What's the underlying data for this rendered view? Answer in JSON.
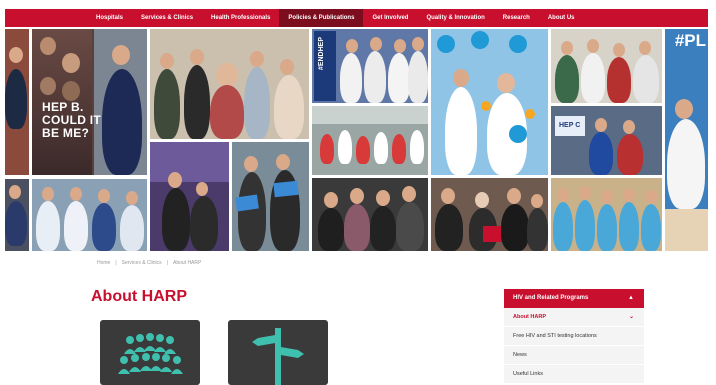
{
  "nav": {
    "items": [
      {
        "label": "Hospitals"
      },
      {
        "label": "Services & Clinics"
      },
      {
        "label": "Health Professionals"
      },
      {
        "label": "Policies & Publications",
        "active": true
      },
      {
        "label": "Get Involved"
      },
      {
        "label": "Quality & Innovation"
      },
      {
        "label": "Research"
      },
      {
        "label": "About Us"
      }
    ]
  },
  "hero": {
    "hepb_text": [
      "HEP B.",
      "COULD IT",
      "BE ME?"
    ],
    "banner_text": "#ENDHEP",
    "hashtag": "#PL",
    "sign_text": "HEP C"
  },
  "breadcrumb": [
    "Home",
    "Services & Clinics",
    "About HARP"
  ],
  "page": {
    "title": "About HARP"
  },
  "sidebar": {
    "header": "HIV and Related Programs",
    "items": [
      {
        "label": "About HARP",
        "active": true
      },
      {
        "label": "Free HIV and STI testing locations"
      },
      {
        "label": "News"
      },
      {
        "label": "Useful Links"
      }
    ]
  },
  "colors": {
    "brand_red": "#c8102e",
    "nav_active": "#7c0d1f",
    "icon_bg": "#3a3a3a",
    "icon_teal": "#3fbfae"
  }
}
